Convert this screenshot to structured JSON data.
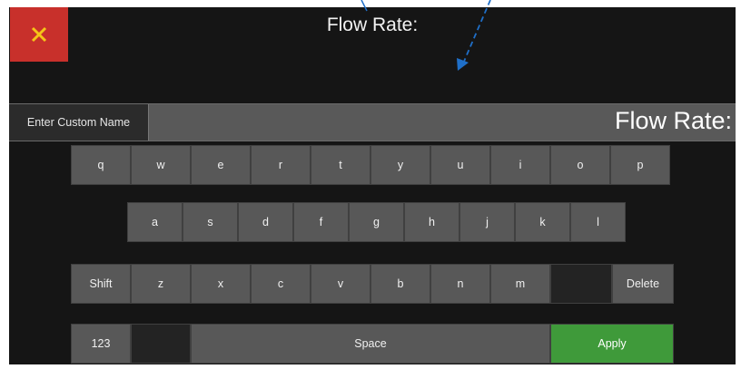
{
  "header": {
    "close_icon": "close-icon",
    "title": "Flow Rate:"
  },
  "name_bar": {
    "label": "Enter Custom Name",
    "value": "Flow Rate:"
  },
  "keyboard": {
    "row1": [
      "q",
      "w",
      "e",
      "r",
      "t",
      "y",
      "u",
      "i",
      "o",
      "p"
    ],
    "row2": [
      "a",
      "s",
      "d",
      "f",
      "g",
      "h",
      "j",
      "k",
      "l"
    ],
    "row3": {
      "shift": "Shift",
      "keys": [
        "z",
        "x",
        "c",
        "v",
        "b",
        "n",
        "m"
      ],
      "delete": "Delete"
    },
    "row4": {
      "numbers": "123",
      "space": "Space",
      "apply": "Apply"
    }
  },
  "colors": {
    "close": "#c8302b",
    "apply": "#3f9a3a",
    "background": "#151515",
    "key": "#585858",
    "callout_arrow": "#1f6fc8"
  }
}
